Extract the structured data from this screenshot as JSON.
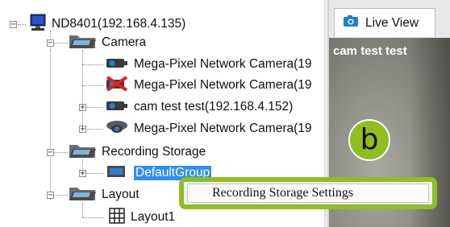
{
  "tree": {
    "root": {
      "label": "ND8401(192.168.4.135)",
      "icon": "computer-monitor-icon"
    },
    "camera_group": {
      "label": "Camera",
      "icon": "folder-icon"
    },
    "cameras": [
      {
        "label": "Mega-Pixel Network Camera(19",
        "icon": "camera-icon",
        "expandable": false
      },
      {
        "label": "Mega-Pixel Network Camera(19",
        "icon": "camera-disconnected-icon",
        "expandable": false
      },
      {
        "label": "cam test test(192.168.4.152)",
        "icon": "camera-icon",
        "expandable": true
      },
      {
        "label": "Mega-Pixel Network Camera(19",
        "icon": "dome-camera-icon",
        "expandable": true
      }
    ],
    "recording_storage": {
      "label": "Recording Storage",
      "icon": "folder-icon"
    },
    "storage_group": {
      "label": "DefaultGroup",
      "icon": "storage-icon",
      "selected": true
    },
    "layout_group": {
      "label": "Layout",
      "icon": "folder-icon"
    },
    "layout_item": {
      "label": "Layout1",
      "icon": "grid-layout-icon"
    }
  },
  "live_view": {
    "tab_label": "Live View",
    "tab_icon": "camera-icon",
    "video_caption": "cam test test"
  },
  "callout": {
    "label": "b",
    "color": "#8fbf1f"
  },
  "context_menu": {
    "items": [
      {
        "label": "Recording Storage Settings"
      }
    ],
    "highlight_color": "#8dbf1f"
  },
  "colors": {
    "selection": "#2f8df3",
    "alert_red": "#e02020"
  }
}
